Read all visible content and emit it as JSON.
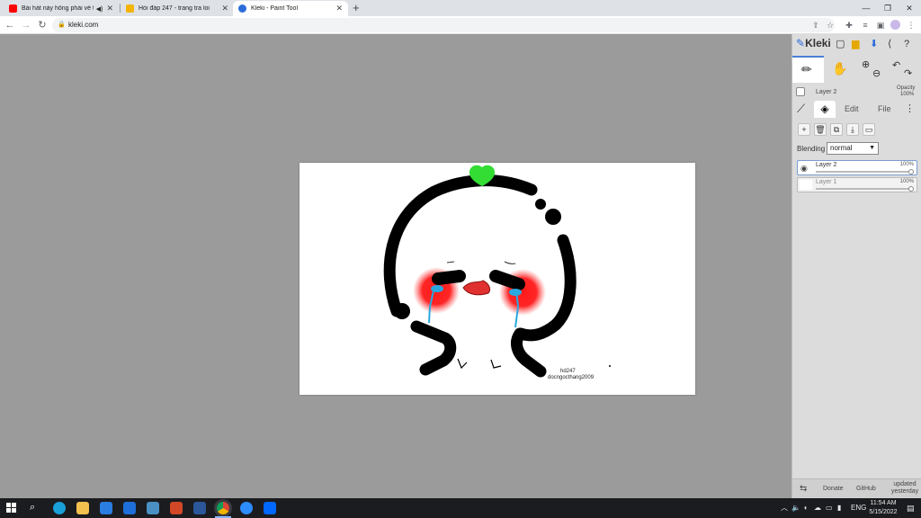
{
  "browser": {
    "tabs": [
      {
        "label": "Bài hát này hông phải về tình",
        "favicon_color": "#ff0000",
        "icon": "youtube-icon",
        "audio": true
      },
      {
        "label": "Hỏi đáp 247 - trang tra loi",
        "favicon_color": "#f4b400",
        "icon": "hoidap-icon"
      },
      {
        "label": "Kleki - Paint Tool",
        "favicon_color": "#2b6cd9",
        "icon": "kleki-icon",
        "active": true
      }
    ],
    "new_tab_label": "+",
    "url": "kleki.com"
  },
  "drawing": {
    "credit_line1": "hd247",
    "credit_line2": "docngocthang2009",
    "colors": {
      "stroke": "#000000",
      "heart": "#33dd33",
      "cheek": "#ff1a1a",
      "tear": "#29a8e0",
      "mouth": "#e03030"
    }
  },
  "kleki": {
    "logo": "Kleki",
    "current_layer_label": "Layer 2",
    "opacity_label": "Opacity",
    "opacity_value": "100%",
    "tabs": {
      "edit": "Edit",
      "file": "File"
    },
    "blending_label": "Blending",
    "blending_value": "normal",
    "layers": [
      {
        "name": "Layer 2",
        "opacity": "100%",
        "active": true
      },
      {
        "name": "Layer 1",
        "opacity": "100%",
        "active": false
      }
    ],
    "footer": {
      "donate": "Donate",
      "github": "GitHub",
      "updated_line1": "updated",
      "updated_line2": "yesterday"
    }
  },
  "taskbar": {
    "lang": "ENG",
    "time": "11:54 AM",
    "date": "5/15/2022",
    "apps": [
      {
        "name": "edge-icon",
        "color": "#1aa0d8"
      },
      {
        "name": "file-explorer-icon",
        "color": "#f2c14e"
      },
      {
        "name": "store-icon",
        "color": "#2a7de1"
      },
      {
        "name": "mail-icon",
        "color": "#1e6fd9"
      },
      {
        "name": "camera-icon",
        "color": "#4a90c4"
      },
      {
        "name": "powerpoint-icon",
        "color": "#d24726"
      },
      {
        "name": "word-icon",
        "color": "#2b579a"
      },
      {
        "name": "chrome-icon",
        "color": "#db4437"
      },
      {
        "name": "zoom-icon",
        "color": "#2d8cff"
      },
      {
        "name": "zalo-icon",
        "color": "#0068ff"
      }
    ]
  }
}
